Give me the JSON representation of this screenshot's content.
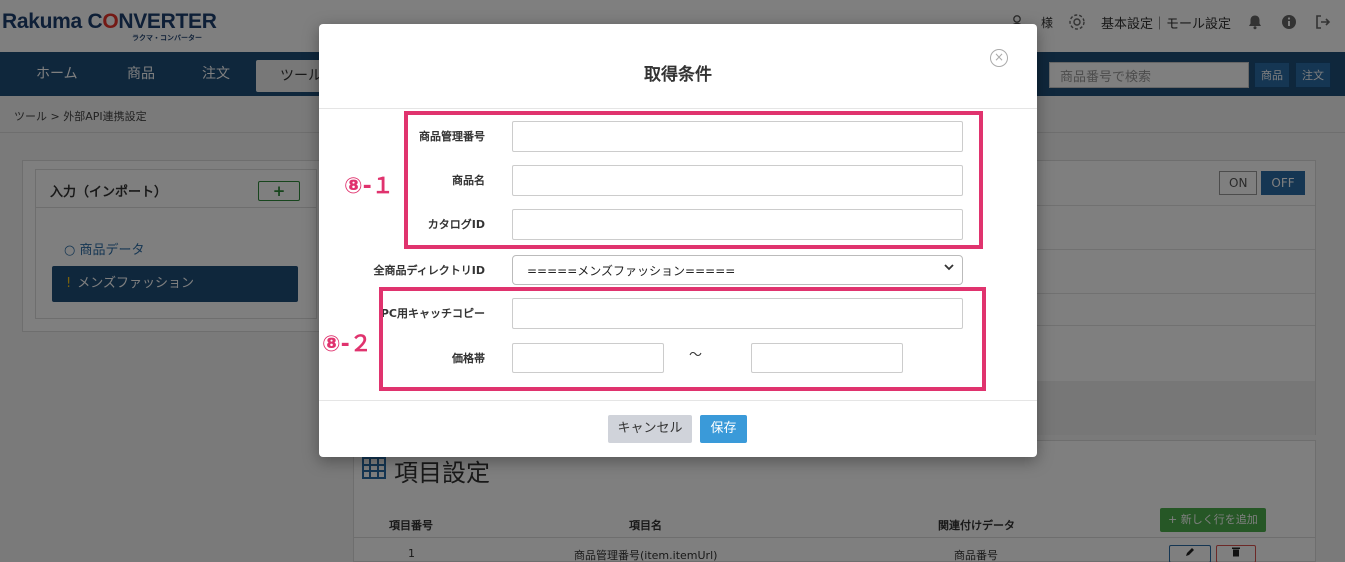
{
  "app": {
    "logo_main_a": "Rakuma C",
    "logo_main_o": "O",
    "logo_main_b": "NVERTER",
    "logo_sub": "ラクマ・コンバーター",
    "user_suffix": "様",
    "settings_link": "基本設定｜モール設定"
  },
  "nav": {
    "items": [
      "ホーム",
      "商品",
      "注文",
      "ツール"
    ],
    "search_placeholder": "商品番号で検索",
    "search_btn_product": "商品",
    "search_btn_order": "注文"
  },
  "breadcrumb": "ツール > 外部API連携設定",
  "left_panel": {
    "title": "入力（インポート）",
    "add_label": "+",
    "tree_link": "商品データ",
    "tree_active": "メンズファッション"
  },
  "right_panel": {
    "on_label": "ON",
    "off_label": "OFF"
  },
  "bottom_panel": {
    "title": "項目設定",
    "add_row_label": "+ 新しく行を追加",
    "columns": [
      "項目番号",
      "項目名",
      "関連付けデータ"
    ],
    "rows": [
      {
        "no": "1",
        "name": "商品管理番号(item.itemUrl)",
        "data": "商品番号"
      }
    ]
  },
  "modal": {
    "title": "取得条件",
    "close_glyph": "×",
    "fields": {
      "product_mgmt_no": "商品管理番号",
      "product_name": "商品名",
      "catalog_id": "カタログID",
      "directory_id": "全商品ディレクトリID",
      "directory_value": "=====メンズファッション=====",
      "pc_catch_copy": "PC用キャッチコピー",
      "price_range": "価格帯",
      "tilde": "〜"
    },
    "cancel_label": "キャンセル",
    "save_label": "保存"
  },
  "annotations": {
    "group1": "⑧-１",
    "group2": "⑧-２",
    "color": "#e0336e"
  }
}
